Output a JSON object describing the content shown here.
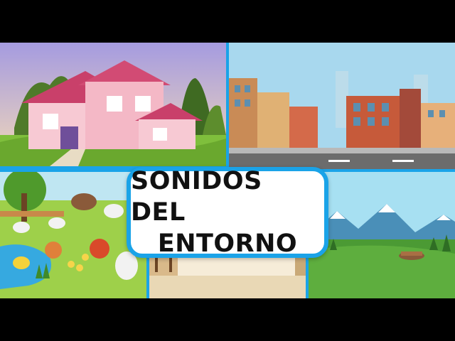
{
  "title": {
    "line1": "SONIDOS DEL",
    "line2": "ENTORNO"
  },
  "scenes": [
    {
      "name": "house"
    },
    {
      "name": "city"
    },
    {
      "name": "farm"
    },
    {
      "name": "classroom"
    },
    {
      "name": "countryside"
    }
  ],
  "colors": {
    "frame": "#1aa3e8",
    "card": "#ffffff",
    "text": "#111111"
  }
}
